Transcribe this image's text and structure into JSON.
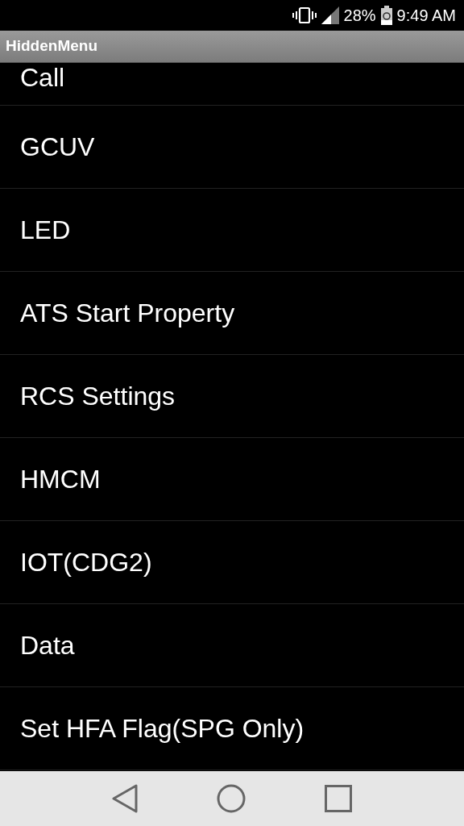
{
  "status_bar": {
    "battery": "28%",
    "time": "9:49 AM"
  },
  "title_bar": {
    "title": "HiddenMenu"
  },
  "menu": {
    "items": [
      {
        "label": "Call"
      },
      {
        "label": "GCUV"
      },
      {
        "label": "LED"
      },
      {
        "label": "ATS Start Property"
      },
      {
        "label": "RCS Settings"
      },
      {
        "label": "HMCM"
      },
      {
        "label": "IOT(CDG2)"
      },
      {
        "label": "Data"
      },
      {
        "label": "Set HFA Flag(SPG Only)"
      }
    ]
  }
}
